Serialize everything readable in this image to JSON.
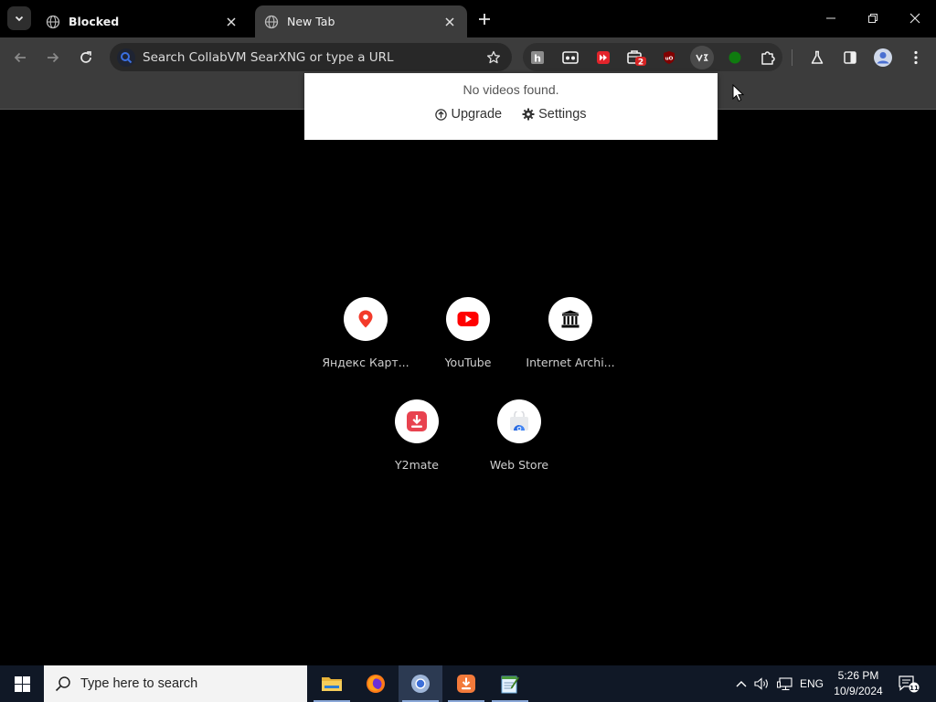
{
  "browser": {
    "tabs": [
      {
        "title": "Blocked",
        "active": false
      },
      {
        "title": "New Tab",
        "active": true
      }
    ],
    "omnibox": {
      "placeholder": "Search CollabVM SearXNG or type a URL"
    },
    "extensions": [
      {
        "name": "h-extension-icon",
        "badge": ""
      },
      {
        "name": "tape-extension-icon",
        "badge": ""
      },
      {
        "name": "fast-forward-extension-icon",
        "badge": ""
      },
      {
        "name": "briefcase-extension-icon",
        "badge": "2"
      },
      {
        "name": "ublock-extension-icon",
        "badge": ""
      },
      {
        "name": "video-downloader-extension-icon",
        "badge": ""
      },
      {
        "name": "green-dot-extension-icon",
        "badge": ""
      }
    ]
  },
  "popup": {
    "message": "No videos found.",
    "upgrade_label": "Upgrade",
    "settings_label": "Settings"
  },
  "shortcuts": [
    {
      "label": "Яндекс Карт...",
      "icon": "map-pin-icon",
      "color": "#f33a2a"
    },
    {
      "label": "YouTube",
      "icon": "youtube-icon",
      "color": "#ff0000"
    },
    {
      "label": "Internet Archi...",
      "icon": "archive-icon",
      "color": "#000000"
    },
    {
      "label": "Y2mate",
      "icon": "download-icon",
      "color": "#e8424f"
    },
    {
      "label": "Web Store",
      "icon": "web-store-icon",
      "color": "#4285f4"
    }
  ],
  "taskbar": {
    "search_placeholder": "Type here to search",
    "language": "ENG",
    "time": "5:26 PM",
    "date": "10/9/2024",
    "notification_count": "11"
  }
}
